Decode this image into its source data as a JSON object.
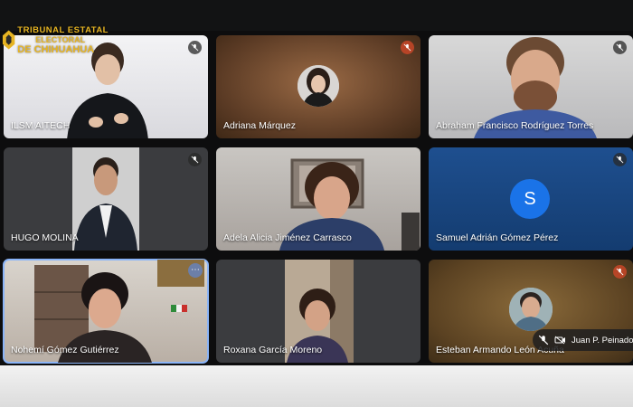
{
  "org_logo": {
    "line1": "TRIBUNAL ESTATAL",
    "line2": "ELECTORAL",
    "line3": "DE CHIHUAHUA"
  },
  "participants": [
    {
      "name": "ILSM AITECH",
      "muted": true
    },
    {
      "name": "Adriana Márquez",
      "muted": true
    },
    {
      "name": "Abraham Francisco Rodríguez Torres",
      "muted": true
    },
    {
      "name": "HUGO MOLINA",
      "muted": true
    },
    {
      "name": "Adela Alicia Jiménez Carrasco",
      "muted": false
    },
    {
      "name": "Samuel Adrián Gómez Pérez",
      "muted": true,
      "avatar_letter": "S"
    },
    {
      "name": "Nohemí Gómez Gutiérrez",
      "muted": false,
      "active": true
    },
    {
      "name": "Roxana García Moreno",
      "muted": false
    },
    {
      "name": "Esteban Armando León Acuña",
      "muted": true
    }
  ],
  "self_view": {
    "name": "Juan P. Peinado"
  },
  "colors": {
    "accent_blue": "#1a73e8",
    "active_outline": "#8ab4f8",
    "logo_gold": "#e6b422"
  },
  "icons": [
    "mic-off-icon",
    "video-off-icon",
    "more-options-icon"
  ]
}
